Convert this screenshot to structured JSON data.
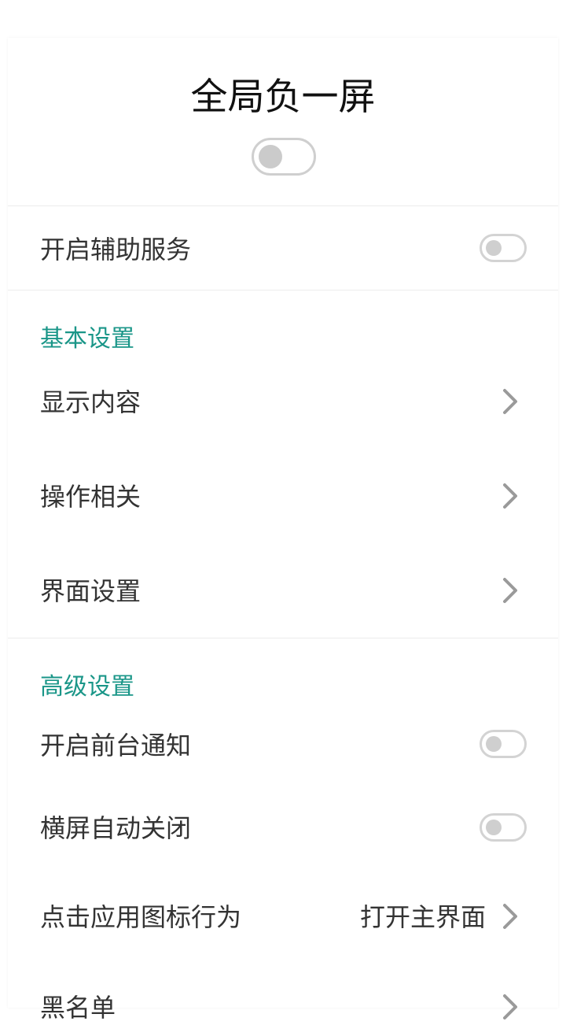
{
  "header": {
    "title": "全局负一屏",
    "master_toggle_on": false
  },
  "accessibility": {
    "label": "开启辅助服务",
    "enabled": false
  },
  "basic_settings": {
    "header": "基本设置",
    "items": [
      {
        "label": "显示内容",
        "icon": "chevron-right-icon"
      },
      {
        "label": "操作相关",
        "icon": "chevron-right-icon"
      },
      {
        "label": "界面设置",
        "icon": "chevron-right-icon"
      }
    ]
  },
  "advanced_settings": {
    "header": "高级设置",
    "foreground_notification": {
      "label": "开启前台通知",
      "enabled": false
    },
    "landscape_auto_close": {
      "label": "横屏自动关闭",
      "enabled": false
    },
    "icon_click_behavior": {
      "label": "点击应用图标行为",
      "value": "打开主界面",
      "icon": "chevron-right-icon"
    },
    "list_item": {
      "label": "黑名单",
      "icon": "chevron-right-icon"
    }
  },
  "colors": {
    "accent": "#1a9688",
    "toggle_off_track": "#d3d3d3",
    "toggle_off_knob": "#cfcfcf",
    "text": "#333333",
    "chevron": "#9a9a9a"
  }
}
